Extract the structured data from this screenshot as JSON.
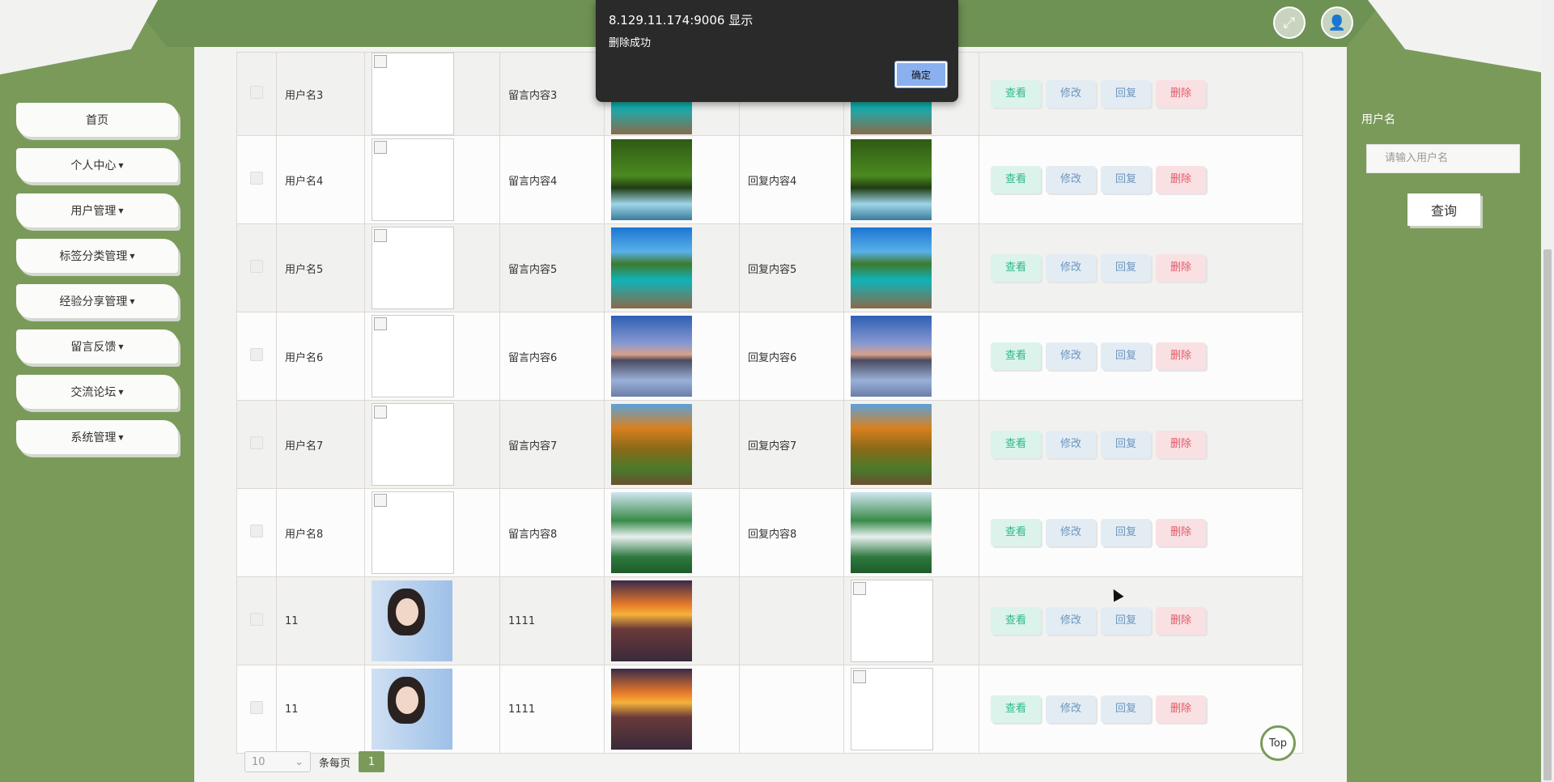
{
  "sidebar": {
    "items": [
      {
        "label": "首页",
        "dropdown": false
      },
      {
        "label": "个人中心",
        "dropdown": true
      },
      {
        "label": "用户管理",
        "dropdown": true
      },
      {
        "label": "标签分类管理",
        "dropdown": true
      },
      {
        "label": "经验分享管理",
        "dropdown": true
      },
      {
        "label": "留言反馈",
        "dropdown": true
      },
      {
        "label": "交流论坛",
        "dropdown": true
      },
      {
        "label": "系统管理",
        "dropdown": true
      }
    ]
  },
  "header": {
    "icons": [
      "fullscreen-icon",
      "user-icon"
    ]
  },
  "table": {
    "actions": {
      "view": "查看",
      "edit": "修改",
      "reply": "回复",
      "delete": "删除"
    },
    "rows": [
      {
        "name": "用户名3",
        "avatar": "broken",
        "message": "留言内容3",
        "image": "pier",
        "reply": "",
        "reply_image": "pier"
      },
      {
        "name": "用户名4",
        "avatar": "broken",
        "message": "留言内容4",
        "image": "forest",
        "reply": "回复内容4",
        "reply_image": "forest"
      },
      {
        "name": "用户名5",
        "avatar": "broken",
        "message": "留言内容5",
        "image": "pier",
        "reply": "回复内容5",
        "reply_image": "pier"
      },
      {
        "name": "用户名6",
        "avatar": "broken",
        "message": "留言内容6",
        "image": "lake",
        "reply": "回复内容6",
        "reply_image": "lake"
      },
      {
        "name": "用户名7",
        "avatar": "broken",
        "message": "留言内容7",
        "image": "autumn",
        "reply": "回复内容7",
        "reply_image": "autumn"
      },
      {
        "name": "用户名8",
        "avatar": "broken",
        "message": "留言内容8",
        "image": "fall",
        "reply": "回复内容8",
        "reply_image": "fall"
      },
      {
        "name": "11",
        "avatar": "girl",
        "message": "1111",
        "image": "sunset",
        "reply": "",
        "reply_image": "broken"
      },
      {
        "name": "11",
        "avatar": "girl",
        "message": "1111",
        "image": "sunset",
        "reply": "",
        "reply_image": "broken"
      }
    ]
  },
  "pager": {
    "page_size": "10",
    "per_page_label": "条每页",
    "current_page": "1"
  },
  "top_button": "Top",
  "search": {
    "label": "用户名",
    "placeholder": "请输入用户名",
    "button": "查询"
  },
  "dialog": {
    "title": "8.129.11.174:9006 显示",
    "message": "删除成功",
    "ok": "确定"
  }
}
